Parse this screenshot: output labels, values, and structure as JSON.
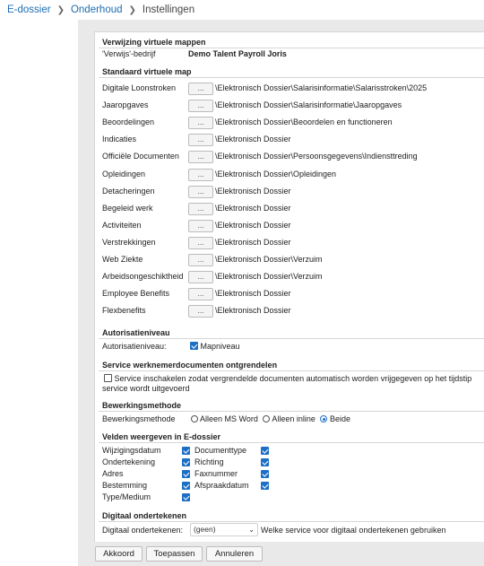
{
  "breadcrumb": {
    "items": [
      "E-dossier",
      "Onderhoud",
      "Instellingen"
    ]
  },
  "verwijzing": {
    "title": "Verwijzing virtuele mappen",
    "label": "'Verwijs'-bedrijf",
    "value": "Demo Talent Payroll Joris"
  },
  "standaard": {
    "title": "Standaard virtuele map",
    "button_label": "...",
    "rows": [
      {
        "label": "Digitale Loonstroken",
        "path": "\\Elektronisch Dossier\\Salarisinformatie\\Salarisstroken\\2025"
      },
      {
        "label": "Jaaropgaves",
        "path": "\\Elektronisch Dossier\\Salarisinformatie\\Jaaropgaves"
      },
      {
        "label": "Beoordelingen",
        "path": "\\Elektronisch Dossier\\Beoordelen en functioneren"
      },
      {
        "label": "Indicaties",
        "path": "\\Elektronisch Dossier"
      },
      {
        "label": "Officiële Documenten",
        "path": "\\Elektronisch Dossier\\Persoonsgegevens\\Indiensttreding"
      },
      {
        "label": "Opleidingen",
        "path": "\\Elektronisch Dossier\\Opleidingen"
      },
      {
        "label": "Detacheringen",
        "path": "\\Elektronisch Dossier"
      },
      {
        "label": "Begeleid werk",
        "path": "\\Elektronisch Dossier"
      },
      {
        "label": "Activiteiten",
        "path": "\\Elektronisch Dossier"
      },
      {
        "label": "Verstrekkingen",
        "path": "\\Elektronisch Dossier"
      },
      {
        "label": "Web Ziekte",
        "path": "\\Elektronisch Dossier\\Verzuim"
      },
      {
        "label": "Arbeidsongeschiktheid",
        "path": "\\Elektronisch Dossier\\Verzuim"
      },
      {
        "label": "Employee Benefits",
        "path": "\\Elektronisch Dossier"
      },
      {
        "label": "Flexbenefits",
        "path": "\\Elektronisch Dossier"
      }
    ]
  },
  "autorisatie": {
    "title": "Autorisatieniveau",
    "label": "Autorisatieniveau:",
    "checkbox_label": "Mapniveau",
    "checked": true
  },
  "service": {
    "title": "Service werknemerdocumenten ontgrendelen",
    "line1": "Service inschakelen zodat vergrendelde documenten automatisch worden vrijgegeven op het tijdstip",
    "line2": "service wordt uitgevoerd",
    "checked": false
  },
  "bewerking": {
    "title": "Bewerkingsmethode",
    "label": "Bewerkingsmethode",
    "options": [
      {
        "label": "Alleen MS Word",
        "selected": false
      },
      {
        "label": "Alleen inline",
        "selected": false
      },
      {
        "label": "Beide",
        "selected": true
      }
    ]
  },
  "velden": {
    "title": "Velden weergeven in E-dossier",
    "left": [
      {
        "label": "Wijzigingsdatum",
        "checked": true
      },
      {
        "label": "Ondertekening",
        "checked": true
      },
      {
        "label": "Adres",
        "checked": true
      },
      {
        "label": "Bestemming",
        "checked": true
      },
      {
        "label": "Type/Medium",
        "checked": true
      }
    ],
    "right": [
      {
        "label": "Documenttype",
        "checked": true
      },
      {
        "label": "Richting",
        "checked": true
      },
      {
        "label": "Faxnummer",
        "checked": true
      },
      {
        "label": "Afspraakdatum",
        "checked": true
      }
    ]
  },
  "digitaal": {
    "title": "Digitaal ondertekenen",
    "label": "Digitaal ondertekenen:",
    "select_value": "(geen)",
    "hint": "Welke service voor digitaal ondertekenen gebruiken"
  },
  "footer": {
    "akkoord": "Akkoord",
    "toepassen": "Toepassen",
    "annuleren": "Annuleren"
  },
  "colors": {
    "accent": "#1d6fc5",
    "link": "#1c6db3",
    "background": "#e9e9e9"
  }
}
